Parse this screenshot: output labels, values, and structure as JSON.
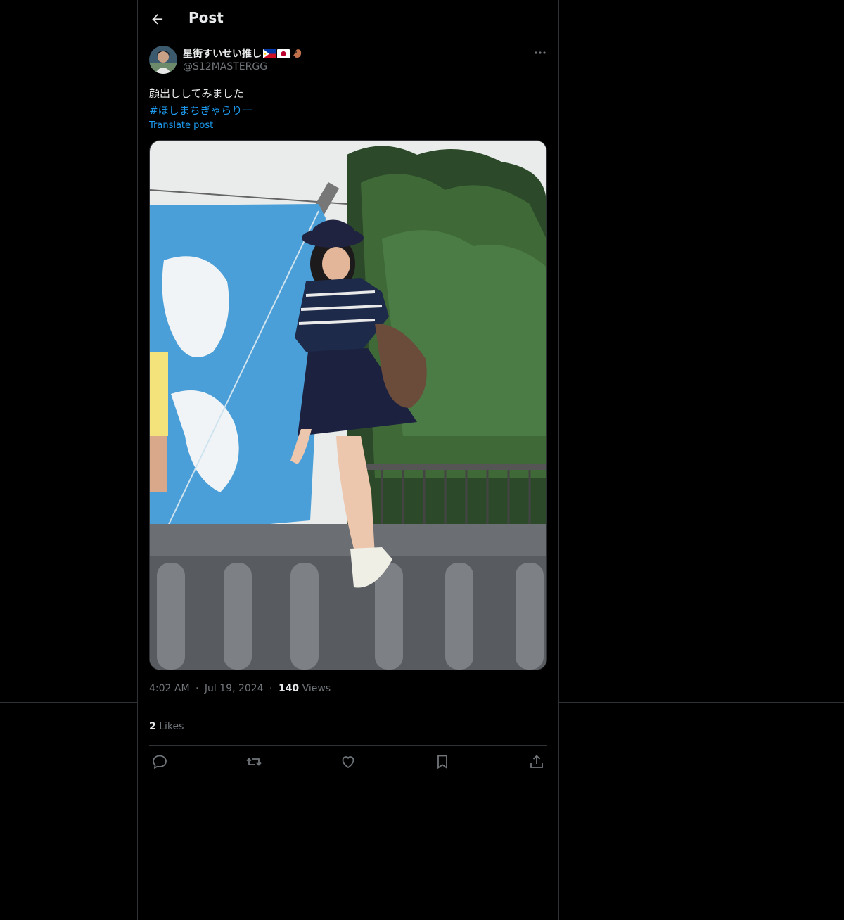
{
  "header": {
    "title": "Post"
  },
  "author": {
    "display_name": "星街すいせい推し",
    "handle": "@S12MASTERGG"
  },
  "post": {
    "text": "顔出ししてみました",
    "hashtag": "#ほしまちぎゃらりー",
    "translate_label": "Translate post"
  },
  "meta": {
    "time": "4:02 AM",
    "separator": "·",
    "date": "Jul 19, 2024",
    "views_count": "140",
    "views_label": "Views"
  },
  "engagement": {
    "likes_count": "2",
    "likes_label": "Likes"
  },
  "icons": {
    "back": "arrow-left-icon",
    "more": "more-horizontal-icon",
    "reply": "reply-icon",
    "repost": "repost-icon",
    "like": "heart-icon",
    "bookmark": "bookmark-icon",
    "share": "share-icon"
  },
  "colors": {
    "background": "#000000",
    "text": "#e7e9ea",
    "secondary": "#71767b",
    "accent": "#1d9bf0",
    "border": "#2f3336"
  }
}
